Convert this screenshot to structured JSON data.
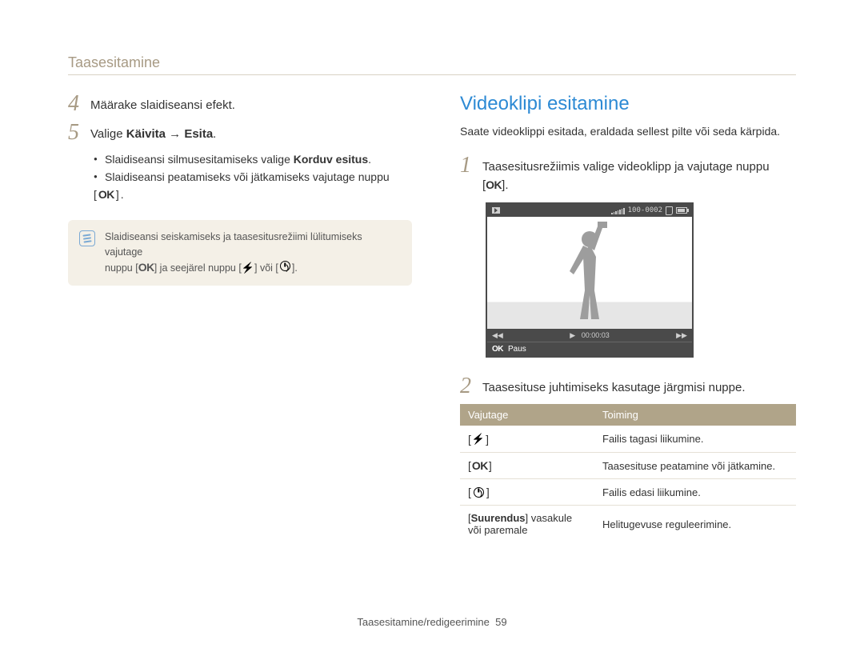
{
  "header": "Taasesitamine",
  "left": {
    "step4": {
      "num": "4",
      "text": "Määrake slaidiseansi efekt."
    },
    "step5": {
      "num": "5",
      "text_pre": "Valige ",
      "text_b1": "Käivita",
      "text_arrow": " → ",
      "text_b2": "Esita",
      "text_suf": "."
    },
    "bullets": {
      "b1_pre": "Slaidiseansi silmusesitamiseks valige ",
      "b1_bold": "Korduv esitus",
      "b1_suf": ".",
      "b2": "Slaidiseansi peatamiseks või jätkamiseks vajutage nuppu"
    },
    "ok_suffix": ".",
    "note": {
      "t1": "Slaidiseansi seiskamiseks ja taasesitusrežiimi lülitumiseks vajutage",
      "t2_pre": "nuppu [",
      "t2_mid": "] ja seejärel nuppu [",
      "t2_mid2": "] või [",
      "t2_suf": "]."
    }
  },
  "right": {
    "title": "Videoklipi esitamine",
    "intro": "Saate videoklippi esitada, eraldada sellest pilte või seda kärpida.",
    "step1": {
      "num": "1",
      "text": "Taasesitusrežiimis valige videoklipp ja vajutage nuppu"
    },
    "ok_suffix": ".",
    "preview": {
      "file_counter": "100-0002",
      "time": "00:00:03",
      "paus_label": "Paus",
      "ok": "OK"
    },
    "step2": {
      "num": "2",
      "text": "Taasesituse juhtimiseks kasutage järgmisi nuppe."
    },
    "table": {
      "col1": "Vajutage",
      "col2": "Toiming",
      "rows": [
        {
          "action": "Failis tagasi liikumine."
        },
        {
          "action": "Taasesituse peatamine või jätkamine."
        },
        {
          "action": "Failis edasi liikumine."
        },
        {
          "action": "Helitugevuse reguleerimine."
        }
      ],
      "zoom_cell_pre": "[",
      "zoom_cell_b": "Suurendus",
      "zoom_cell_mid": "] vasakule või paremale"
    }
  },
  "footer": {
    "text": "Taasesitamine/redigeerimine",
    "page": "59"
  },
  "icons": {
    "ok": "OK"
  }
}
